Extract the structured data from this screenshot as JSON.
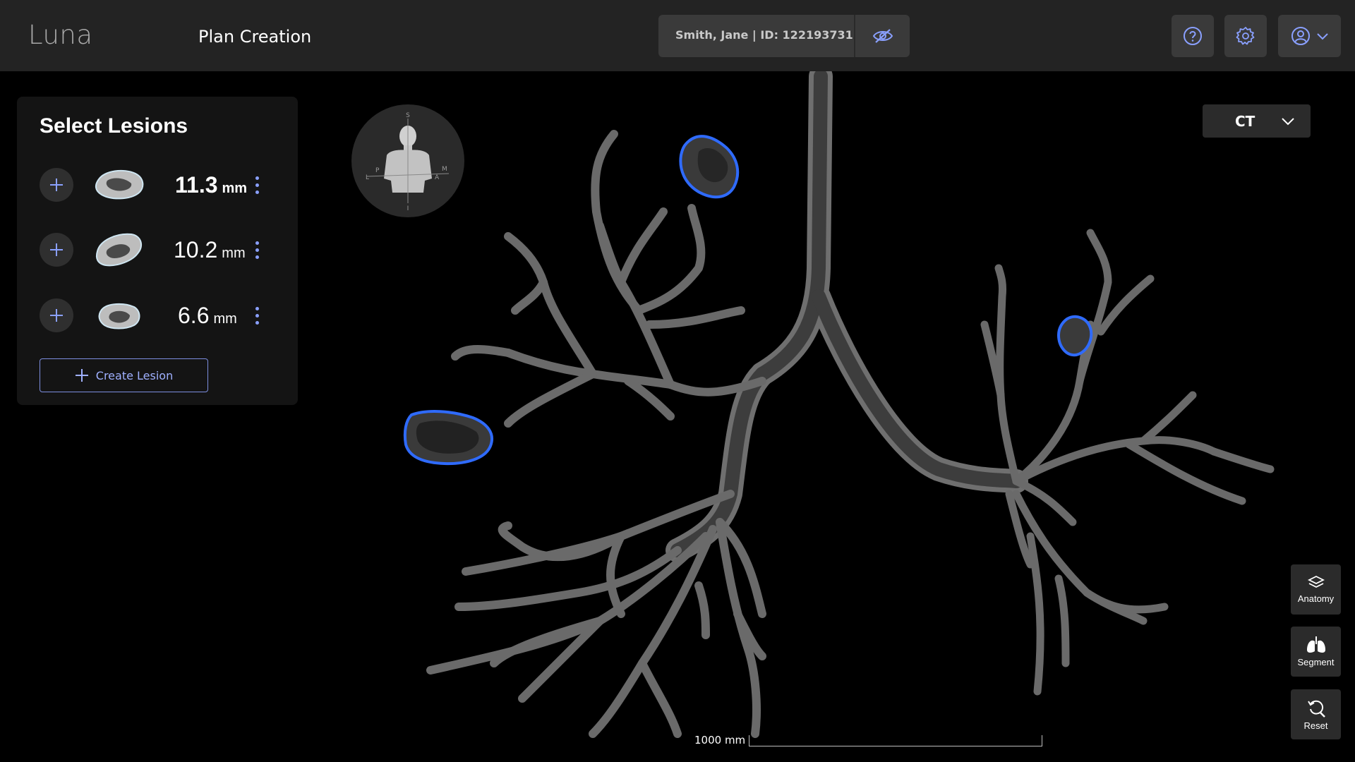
{
  "app": {
    "logo": "Luna",
    "page_title": "Plan Creation"
  },
  "patient": {
    "label": "Smith, Jane | ID: 122193731",
    "visibility_icon": "eye-off-icon"
  },
  "header_icons": {
    "help": "help-circle-icon",
    "settings": "gear-icon",
    "user": "user-circle-icon",
    "user_menu": "chevron-down-icon"
  },
  "lesions_panel": {
    "title": "Select Lesions",
    "lesions": [
      {
        "size": "11.3",
        "unit": "mm",
        "emphasized": true
      },
      {
        "size": "10.2",
        "unit": "mm",
        "emphasized": false
      },
      {
        "size": "6.6",
        "unit": "mm",
        "emphasized": false
      }
    ],
    "create_label": "Create Lesion"
  },
  "viewer": {
    "modality": "CT",
    "orientation_labels": {
      "superior": "S",
      "inferior": "I",
      "left": "L",
      "anterior": "A",
      "posterior": "P",
      "medial": "M"
    },
    "tools": [
      {
        "label": "Anatomy",
        "icon": "layers-icon"
      },
      {
        "label": "Segment",
        "icon": "lungs-icon"
      },
      {
        "label": "Reset",
        "icon": "reset-zoom-icon"
      }
    ],
    "scale_label": "1000 mm"
  },
  "colors": {
    "accent": "#8aa0ff",
    "lesion_outline": "#2f6bff",
    "topbar": "#232323",
    "panel": "#141414"
  }
}
